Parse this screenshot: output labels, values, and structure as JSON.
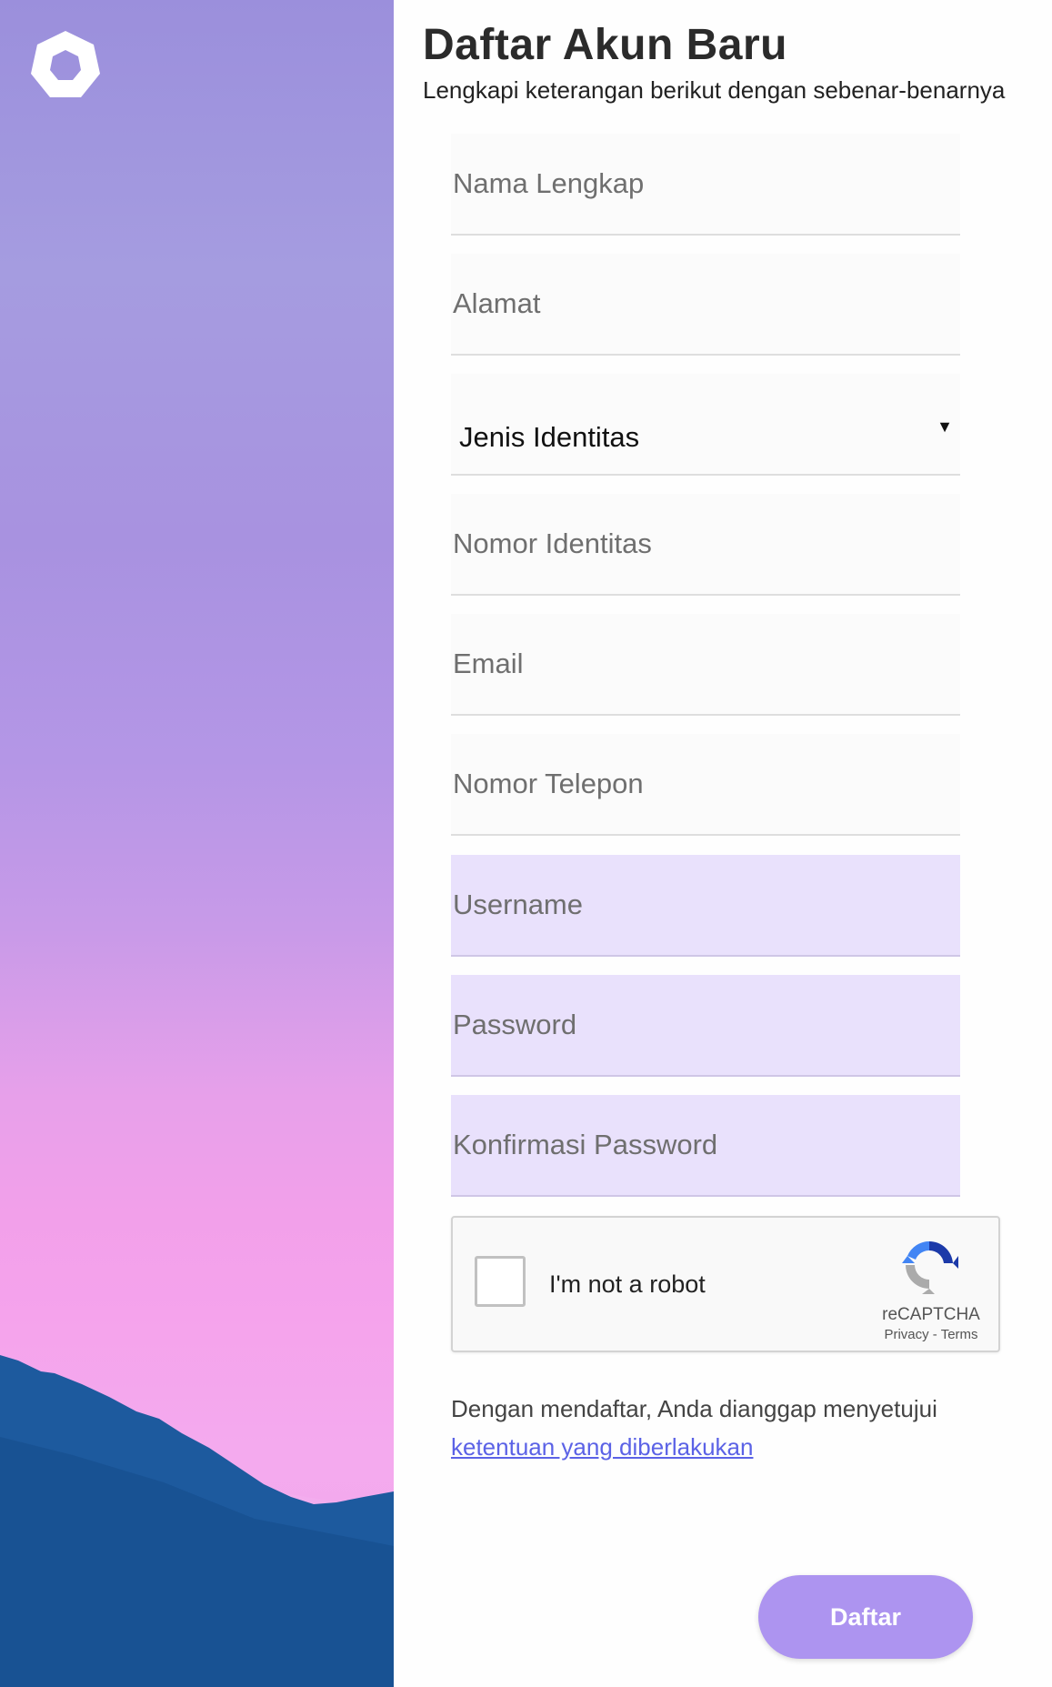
{
  "header": {
    "title": "Daftar Akun Baru",
    "subtitle": "Lengkapi keterangan berikut dengan sebenar-benarnya"
  },
  "form": {
    "full_name": {
      "placeholder": "Nama Lengkap",
      "value": ""
    },
    "address": {
      "placeholder": "Alamat",
      "value": ""
    },
    "id_type": {
      "selected": "Jenis Identitas"
    },
    "id_number": {
      "placeholder": "Nomor Identitas",
      "value": ""
    },
    "email": {
      "placeholder": "Email",
      "value": ""
    },
    "phone": {
      "placeholder": "Nomor Telepon",
      "value": ""
    },
    "username": {
      "placeholder": "Username",
      "value": ""
    },
    "password": {
      "placeholder": "Password",
      "value": ""
    },
    "confirm_password": {
      "placeholder": "Konfirmasi Password",
      "value": ""
    }
  },
  "recaptcha": {
    "label": "I'm not a robot",
    "brand": "reCAPTCHA",
    "privacy": "Privacy",
    "separator": " - ",
    "terms": "Terms",
    "checked": false
  },
  "terms": {
    "text": "Dengan mendaftar, Anda dianggap menyetujui",
    "link_label": "ketentuan yang diberlakukan"
  },
  "submit_label": "Daftar",
  "colors": {
    "accent": "#ad94f0",
    "highlight_field": "#e9e1fc",
    "link": "#5b62e6",
    "mountain": "#1d5a9e"
  },
  "icons": {
    "logo": "heptagon-ring-logo-icon",
    "dropdown": "caret-down-icon",
    "captcha": "recaptcha-logo-icon"
  }
}
